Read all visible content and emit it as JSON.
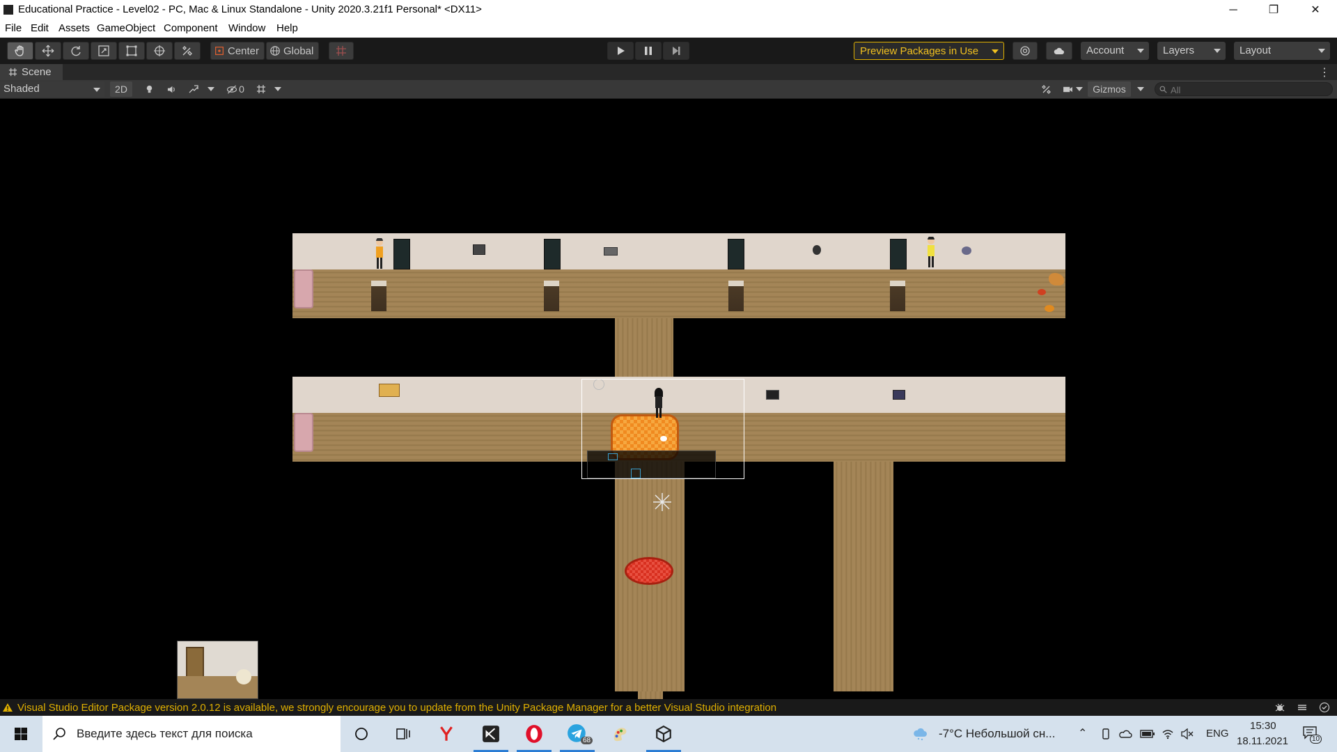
{
  "window": {
    "title": "Educational Practice - Level02 - PC, Mac & Linux Standalone - Unity 2020.3.21f1 Personal* <DX11>",
    "minimize_glyph": "─",
    "maximize_glyph": "❐",
    "close_glyph": "✕"
  },
  "menu": {
    "items": [
      "File",
      "Edit",
      "Assets",
      "GameObject",
      "Component",
      "Window",
      "Help"
    ]
  },
  "toolbar": {
    "pivot_label": "Center",
    "space_label": "Global",
    "preview_packages_label": "Preview Packages in Use",
    "account_label": "Account",
    "layers_label": "Layers",
    "layout_label": "Layout",
    "accent_color": "#e0b000"
  },
  "scene_tab": {
    "label": "Scene"
  },
  "scene_toolbar": {
    "shading_mode": "Shaded",
    "mode_2d_label": "2D",
    "hidden_count": "0",
    "gizmos_label": "Gizmos",
    "search_placeholder": "All"
  },
  "status": {
    "message": "Visual Studio Editor Package version 2.0.12 is available, we strongly encourage you to update from the Unity Package Manager for a better Visual Studio integration",
    "color": "#e0b000"
  },
  "taskbar": {
    "search_placeholder": "Введите здесь текст для поиска",
    "telegram_badge": "68",
    "weather": "-7°C  Небольшой сн...",
    "language": "ENG",
    "time": "15:30",
    "date": "18.11.2021",
    "notifications_count": "10"
  }
}
